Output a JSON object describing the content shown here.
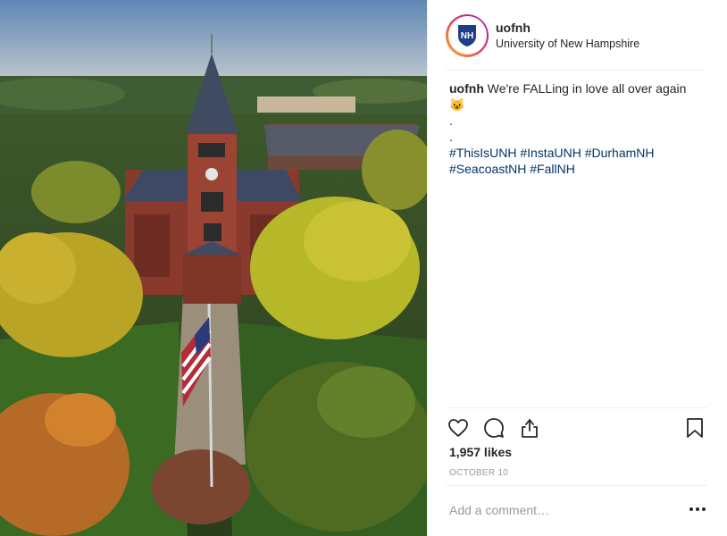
{
  "post": {
    "username": "uofnh",
    "full_name": "University of New Hampshire",
    "avatar_icon": "unh-shield-logo",
    "avatar_text": "NH",
    "caption": {
      "username": "uofnh",
      "text": "We're FALLing in love all over again",
      "emoji": "😺",
      "dot_1": ".",
      "dot_2": ".",
      "hashtags_line_1": "#ThisIsUNH #InstaUNH #DurhamNH",
      "hashtags_line_2": "#SeacoastNH #FallNH"
    },
    "likes": "1,957 likes",
    "date": "OCTOBER 10",
    "comment_placeholder": "Add a comment…",
    "photo_description_icon": "campus-aerial-photo"
  },
  "icons": {
    "like": "heart-icon",
    "comment": "comment-icon",
    "share": "share-icon",
    "save": "bookmark-icon",
    "more": "more-options-icon"
  },
  "colors": {
    "hashtag": "#003569",
    "avatar_shield": "#1e3f86",
    "muted": "#999999",
    "text": "#262626"
  }
}
